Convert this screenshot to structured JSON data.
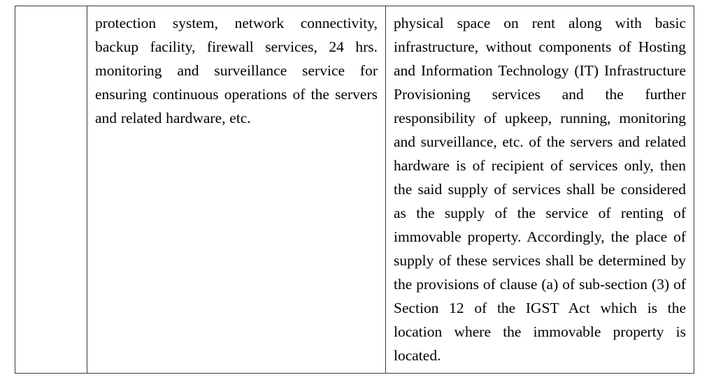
{
  "document": {
    "type": "table-excerpt",
    "background_color": "#ffffff",
    "text_color": "#000000",
    "border_color": "#3a3a3a",
    "columns": [
      {
        "name": "marker-column",
        "content": ""
      },
      {
        "name": "description-column",
        "content": ""
      },
      {
        "name": "clarification-column",
        "content": ""
      }
    ],
    "row": {
      "marker_cell": "",
      "left_cell": "protection system, network connectivity, backup facility, firewall services, 24 hrs. monitoring and surveillance service for ensuring continuous operations of the servers and related hardware, etc.",
      "right_cell": "physical space on rent along with basic infrastructure, without components of Hosting and Information Technology (IT) Infrastructure Provisioning services and the further responsibility of upkeep, running, monitoring and surveillance, etc. of the servers and related hardware is of recipient of services only, then the said supply of services shall be considered as the  supply of the service of renting of immovable property. Accordingly, the place of supply of these services shall be determined by the provisions of clause (a) of sub-section (3) of Section 12 of the IGST Act which is the location where the immovable property is located."
    },
    "left_cell_lines": [
      "protection system, network",
      "connectivity, backup facility,",
      "firewall services, 24 hrs.",
      "monitoring and surveillance",
      "service for ensuring continuous",
      "operations of the servers and",
      "related hardware, etc."
    ],
    "right_cell_lines": [
      "physical space on rent along with basic",
      "infrastructure, without components of",
      "Hosting and Information Technology (IT)",
      "Infrastructure Provisioning services and",
      "the further responsibility of upkeep,",
      "running, monitoring and surveillance, etc.",
      "of the servers and related hardware is of",
      "recipient of services only, then the said",
      "supply of services shall be considered as",
      "the  supply of the service of renting of",
      "immovable property. Accordingly, the",
      "place of supply of these services shall be",
      "determined by the provisions of clause",
      "(a) of sub-section (3) of Section 12 of the",
      "IGST Act which is the location where the",
      "immovable property is located."
    ]
  }
}
